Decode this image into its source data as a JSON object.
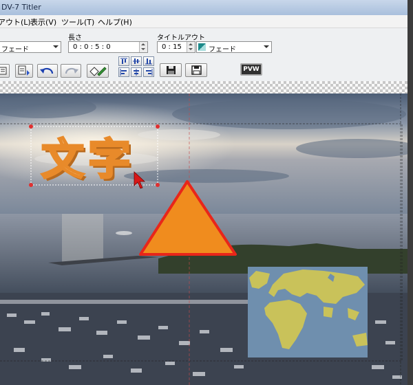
{
  "window": {
    "title": "DV-7 Titler"
  },
  "menu": [
    "アウト(L)",
    "表示(V)",
    "ツール(T)",
    "ヘルプ(H)"
  ],
  "toolbar": {
    "transition_in": {
      "value": "フェード"
    },
    "length": {
      "label": "長さ",
      "value": "0 : 0 : 5 : 0"
    },
    "title_out": {
      "label": "タイトルアウト",
      "time": "0 : 15",
      "transition": "フェード"
    },
    "preview_label": "PVW"
  },
  "canvas": {
    "title_text": "文字",
    "colors": {
      "text_fill": "#ffffff",
      "text_outline": "#e88a2a",
      "triangle_fill": "#f08c1e",
      "triangle_stroke": "#e8261a",
      "map_ocean": "#6f8fae",
      "map_land": "#c9c25a"
    }
  }
}
